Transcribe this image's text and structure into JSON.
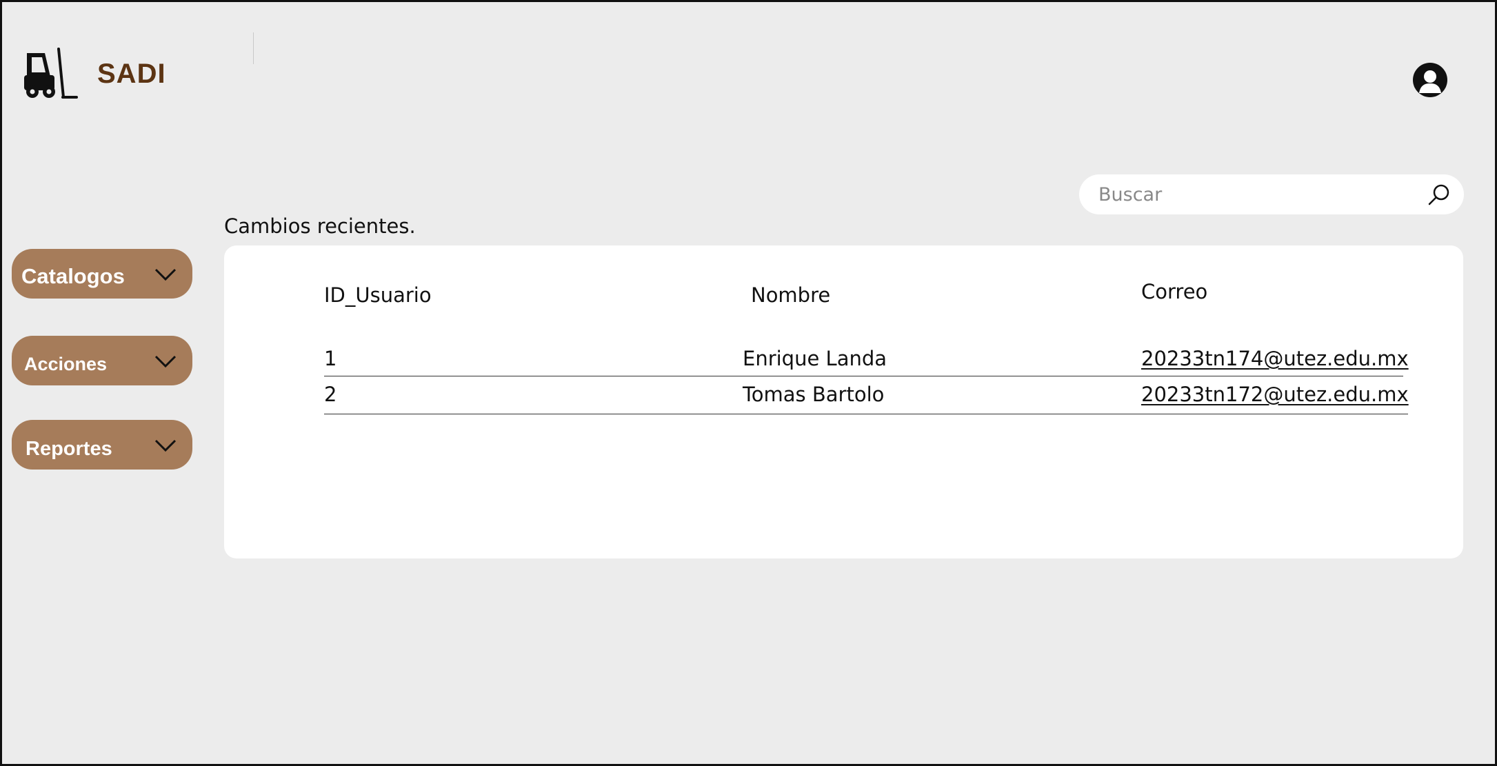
{
  "app": {
    "brand": "SADI",
    "logo_icon": "forklift-icon",
    "profile_icon": "user-avatar-icon"
  },
  "search": {
    "placeholder": "Buscar",
    "value": "",
    "icon": "search-icon"
  },
  "sidebar": {
    "items": [
      {
        "label": "Catalogos",
        "icon": "chevron-down-icon"
      },
      {
        "label": "Acciones",
        "icon": "chevron-down-icon"
      },
      {
        "label": "Reportes",
        "icon": "chevron-down-icon"
      }
    ]
  },
  "main": {
    "section_title": "Cambios recientes.",
    "table": {
      "columns": [
        "ID_Usuario",
        "Nombre",
        "Correo"
      ],
      "rows": [
        {
          "id": "1",
          "nombre": "Enrique Landa",
          "correo": "20233tn174@utez.edu.mx"
        },
        {
          "id": "2",
          "nombre": "Tomas Bartolo",
          "correo": "20233tn172@utez.edu.mx"
        }
      ]
    }
  },
  "colors": {
    "background": "#ececec",
    "brand_text": "#5c3413",
    "nav_button": "#a67c5a",
    "card": "#ffffff"
  }
}
